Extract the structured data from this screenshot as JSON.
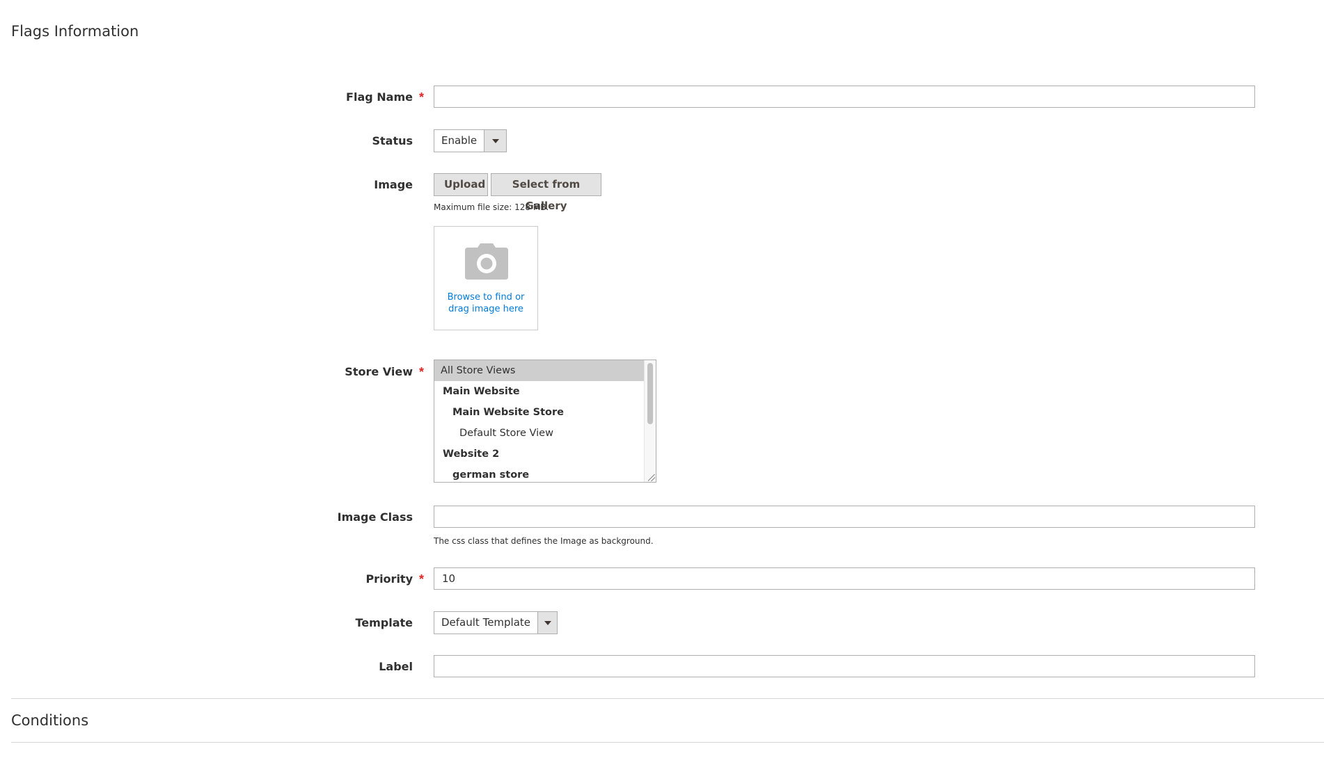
{
  "section": {
    "title": "Flags Information",
    "conditions_title": "Conditions"
  },
  "fields": {
    "flag_name": {
      "label": "Flag Name",
      "value": "",
      "required": "*"
    },
    "status": {
      "label": "Status",
      "value": "Enable"
    },
    "image": {
      "label": "Image",
      "upload_label": "Upload",
      "gallery_label": "Select from Gallery",
      "max_size_note": "Maximum file size: 128 MB.",
      "dropzone_line1": "Browse to find or",
      "dropzone_line2": "drag image here"
    },
    "store_view": {
      "label": "Store View",
      "required": "*",
      "options": [
        "All Store Views",
        "Main Website",
        "Main Website Store",
        "Default Store View",
        "Website 2",
        "german store"
      ]
    },
    "image_class": {
      "label": "Image Class",
      "value": "",
      "note": "The css class that defines the Image as background."
    },
    "priority": {
      "label": "Priority",
      "value": "10",
      "required": "*"
    },
    "template": {
      "label": "Template",
      "value": "Default Template"
    },
    "label": {
      "label": "Label",
      "value": ""
    }
  },
  "icons": {
    "dropdown": "triangle-down-icon",
    "camera": "camera-icon"
  }
}
